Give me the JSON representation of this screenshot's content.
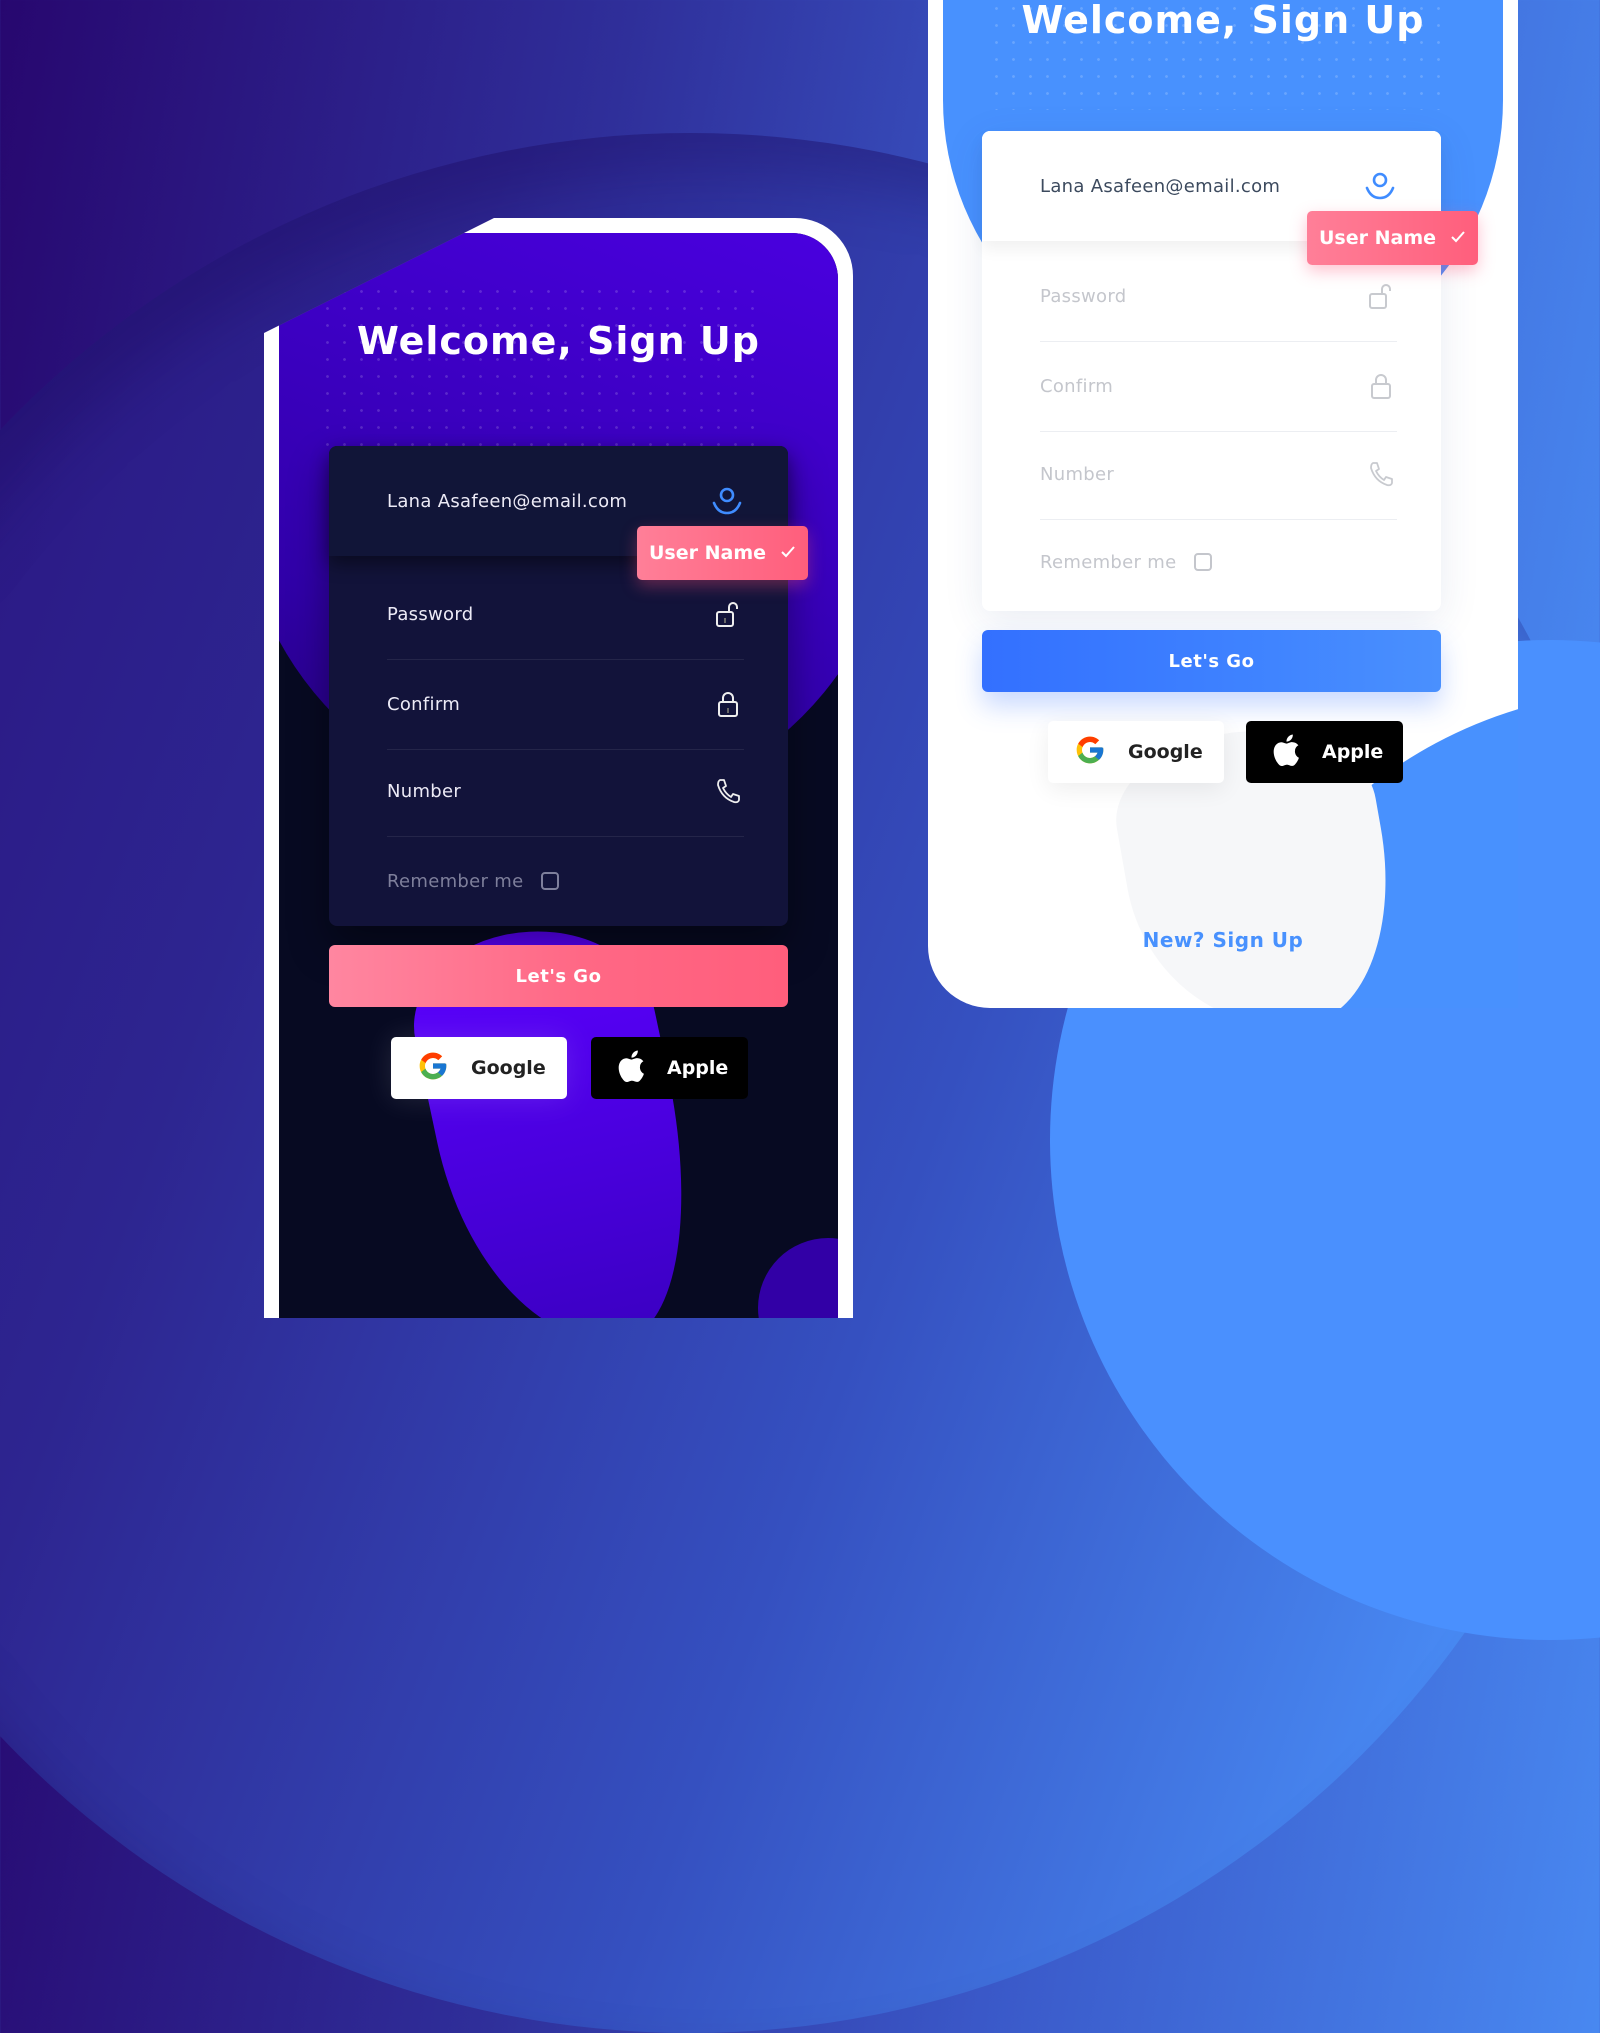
{
  "colors": {
    "dark_accent": "#5a00ff",
    "dark_card": "#12133a",
    "pink_accent": "#ff5e7c",
    "light_accent": "#4891fe",
    "user_icon": "#3f8cff"
  },
  "dark_screen": {
    "title": "Welcome, Sign Up",
    "fields": [
      {
        "label": "Lana Asafeen@email.com",
        "icon": "user-icon"
      },
      {
        "label": "Password",
        "icon": "unlock-icon"
      },
      {
        "label": "Confirm",
        "icon": "lock-icon"
      },
      {
        "label": "Number",
        "icon": "phone-icon"
      }
    ],
    "remember_label": "Remember me",
    "remember_checked": false,
    "tooltip": {
      "label": "User Name",
      "icon": "check-icon"
    },
    "cta_label": "Let's Go",
    "social": [
      {
        "label": "Google",
        "icon": "google-icon"
      },
      {
        "label": "Apple",
        "icon": "apple-icon"
      }
    ]
  },
  "light_screen": {
    "title": "Welcome, Sign Up",
    "fields": [
      {
        "label": "Lana Asafeen@email.com",
        "icon": "user-icon"
      },
      {
        "label": "Password",
        "icon": "unlock-icon"
      },
      {
        "label": "Confirm",
        "icon": "lock-icon"
      },
      {
        "label": "Number",
        "icon": "phone-icon"
      }
    ],
    "remember_label": "Remember me",
    "remember_checked": false,
    "tooltip": {
      "label": "User Name",
      "icon": "check-icon"
    },
    "cta_label": "Let's Go",
    "social": [
      {
        "label": "Google",
        "icon": "google-icon"
      },
      {
        "label": "Apple",
        "icon": "apple-icon"
      }
    ],
    "signup_link": "New? Sign Up"
  }
}
